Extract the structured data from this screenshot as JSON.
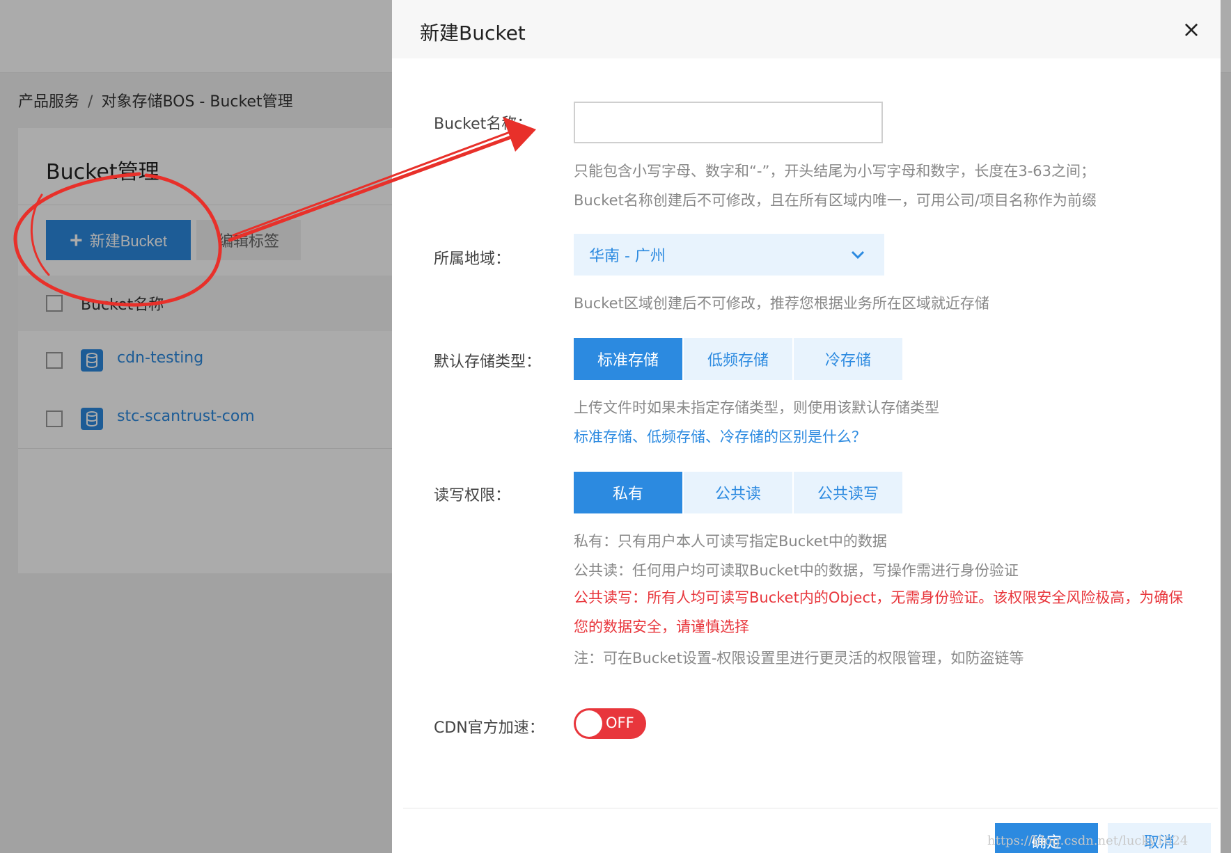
{
  "background": {
    "breadcrumb": {
      "root": "产品服务",
      "separator": "/",
      "current": "对象存储BOS - Bucket管理"
    },
    "card_title": "Bucket管理",
    "new_bucket_button": "新建Bucket",
    "edit_tag_button": "编辑标签",
    "list_header": "Bucket名称",
    "buckets": [
      "cdn-testing",
      "stc-scantrust-com"
    ]
  },
  "modal": {
    "title": "新建Bucket",
    "name": {
      "label": "Bucket名称：",
      "value": "",
      "hint1": "只能包含小写字母、数字和“-”，开头结尾为小写字母和数字，长度在3-63之间；",
      "hint2": "Bucket名称创建后不可修改，且在所有区域内唯一，可用公司/项目名称作为前缀"
    },
    "region": {
      "label": "所属地域：",
      "selected": "华南 - 广州",
      "hint": "Bucket区域创建后不可修改，推荐您根据业务所在区域就近存储"
    },
    "storage_class": {
      "label": "默认存储类型：",
      "options": [
        "标准存储",
        "低频存储",
        "冷存储"
      ],
      "selected": "标准存储",
      "hint": "上传文件时如果未指定存储类型，则使用该默认存储类型",
      "link": "标准存储、低频存储、冷存储的区别是什么？"
    },
    "acl": {
      "label": "读写权限：",
      "options": [
        "私有",
        "公共读",
        "公共读写"
      ],
      "selected": "私有",
      "hint_private": "私有：只有用户本人可读写指定Bucket中的数据",
      "hint_public_read": "公共读：任何用户均可读取Bucket中的数据，写操作需进行身份验证",
      "hint_public_rw": "公共读写：所有人均可读写Bucket内的Object，无需身份验证。该权限安全风险极高，为确保您的数据安全，请谨慎选择",
      "note": "注：可在Bucket设置-权限设置里进行更灵活的权限管理，如防盗链等"
    },
    "cdn": {
      "label": "CDN官方加速：",
      "state": "OFF"
    },
    "ok_button": "确定",
    "cancel_button": "取消"
  },
  "watermark": "https://blog.csdn.net/lucky1024",
  "colors": {
    "primary": "#2c8ae0",
    "primary_light": "#e8f3fd",
    "danger": "#e8363c",
    "annotation": "#e8302a"
  },
  "icons": [
    "plus-icon",
    "database-icon",
    "chevron-down-icon",
    "close-icon"
  ]
}
